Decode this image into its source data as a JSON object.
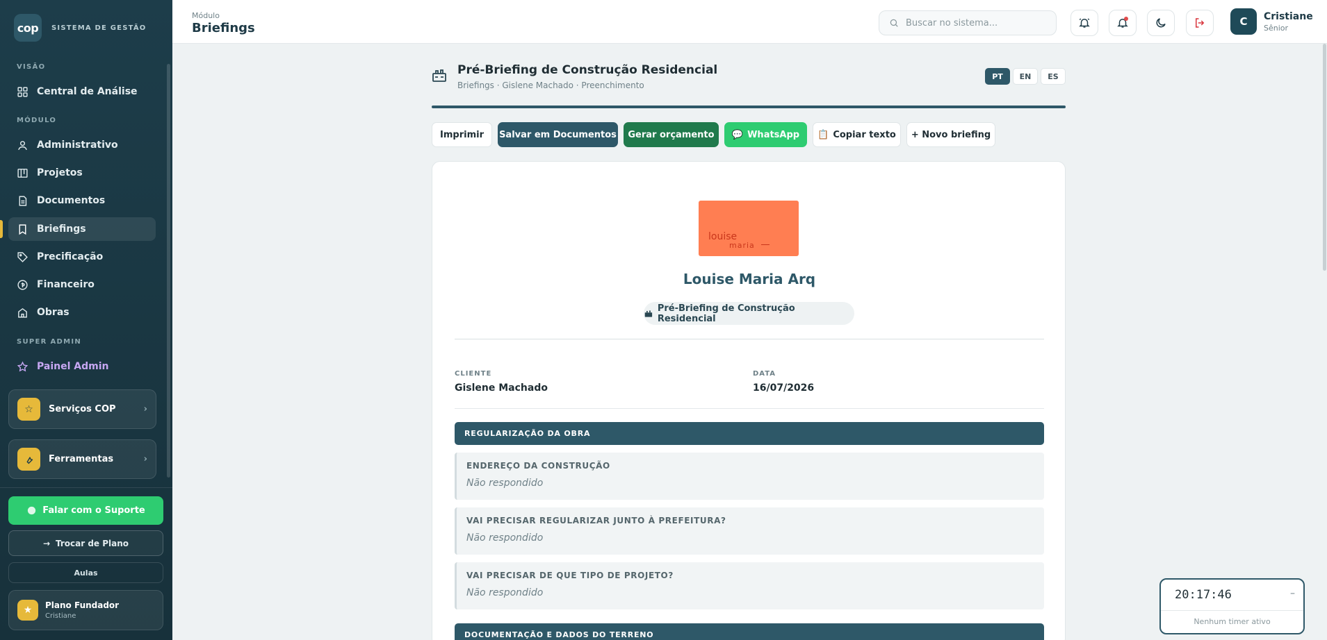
{
  "sidebar": {
    "brand_logo": "cop",
    "brand_text": "SISTEMA DE GESTÃO",
    "section_visao": "VISÃO",
    "item_central": "Central de Análise",
    "section_modulo": "MÓDULO",
    "items": [
      "Administrativo",
      "Projetos",
      "Documentos",
      "Briefings",
      "Precificação",
      "Financeiro",
      "Obras"
    ],
    "section_super": "SUPER ADMIN",
    "item_admin": "Painel Admin",
    "servicos": "Serviços COP",
    "ferramentas": "Ferramentas",
    "support": "Falar com o Suporte",
    "trocar": "Trocar de Plano",
    "aulas": "Aulas",
    "plan_name": "Plano Fundador",
    "plan_user": "Cristiane"
  },
  "topbar": {
    "module_label": "Módulo",
    "module_title": "Briefings",
    "search_placeholder": "Buscar no sistema...",
    "user_initial": "C",
    "user_name": "Cristiane",
    "user_role": "Sênior"
  },
  "doc": {
    "title": "Pré-Briefing de Construção Residencial",
    "crumb": "Briefings · Gislene Machado · Preenchimento",
    "langs": [
      "PT",
      "EN",
      "ES"
    ],
    "actions": [
      "Imprimir",
      "Salvar em Documentos",
      "Gerar orçamento",
      "WhatsApp",
      "Copiar texto",
      "+ Novo briefing"
    ]
  },
  "paper": {
    "logo_line1": "louise",
    "logo_line2": "maria",
    "office_name": "Louise Maria Arq",
    "pill": "Pré-Briefing de Construção Residencial",
    "client_label": "CLIENTE",
    "client_value": "Gislene Machado",
    "date_label": "DATA",
    "date_value": "16/07/2026",
    "section1": "REGULARIZAÇÃO DA OBRA",
    "questions": [
      {
        "q": "ENDEREÇO DA CONSTRUÇÃO",
        "a": "Não respondido"
      },
      {
        "q": "VAI PRECISAR REGULARIZAR JUNTO À PREFEITURA?",
        "a": "Não respondido"
      },
      {
        "q": "VAI PRECISAR DE QUE TIPO DE PROJETO?",
        "a": "Não respondido"
      }
    ],
    "section2": "DOCUMENTAÇÃO E DADOS DO TERRENO"
  },
  "timer": {
    "clock": "20:17:46",
    "minimize": "–",
    "status": "Nenhum timer ativo"
  },
  "colors": {
    "sidebar_bg": "#1d3d4a",
    "primary": "#2e5868",
    "accent_gold": "#e6b93a",
    "whatsapp": "#2ecc71",
    "quote_green": "#207a4c",
    "logo_orange": "#ff7e52"
  }
}
